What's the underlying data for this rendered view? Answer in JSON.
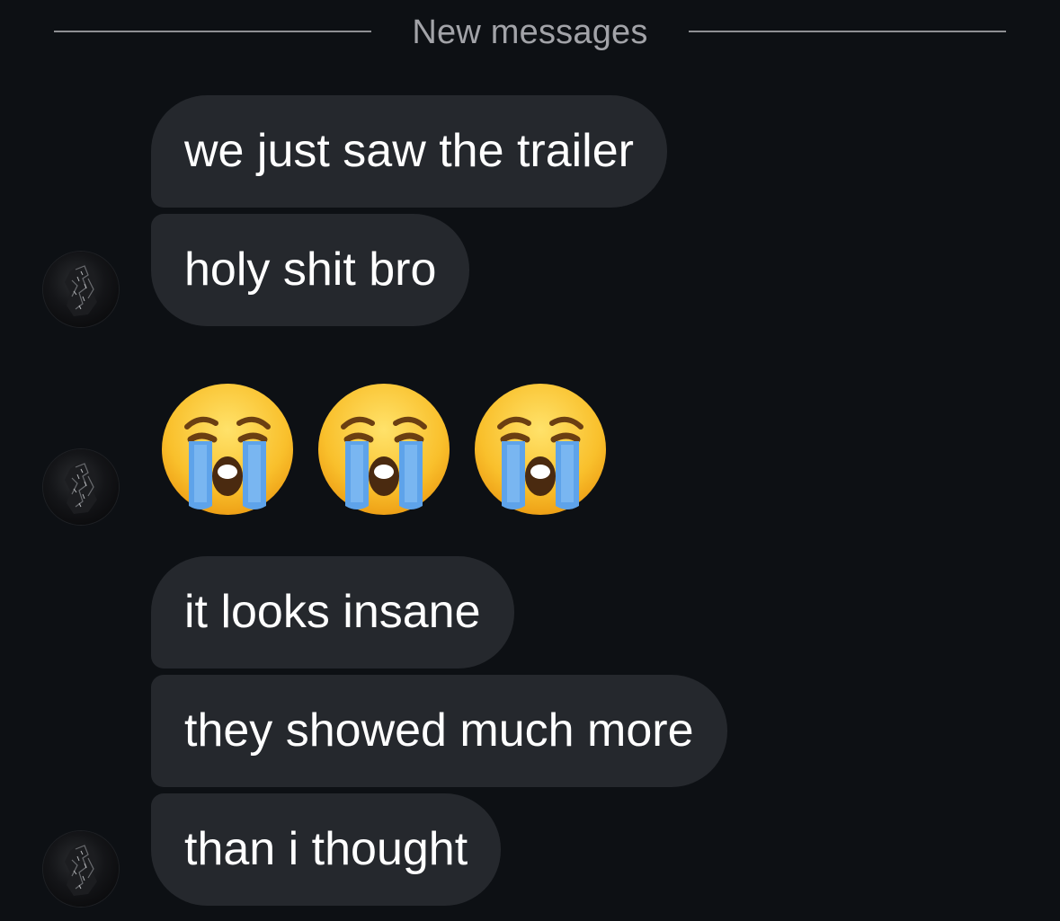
{
  "divider": {
    "label": "New messages"
  },
  "messages": [
    {
      "kind": "text",
      "text": "we just saw the trailer"
    },
    {
      "kind": "text",
      "text": "holy shit bro"
    },
    {
      "kind": "emoji",
      "icons": [
        "loudly-crying-face-icon",
        "loudly-crying-face-icon",
        "loudly-crying-face-icon"
      ]
    },
    {
      "kind": "text",
      "text": "it looks insane"
    },
    {
      "kind": "text",
      "text": "they showed much more"
    },
    {
      "kind": "text",
      "text": "than i thought"
    }
  ],
  "colors": {
    "background": "#0d1014",
    "bubble": "#25282d",
    "divider_text": "#a2a3a8",
    "divider_line": "#8e8f93",
    "message_text": "#ffffff"
  }
}
